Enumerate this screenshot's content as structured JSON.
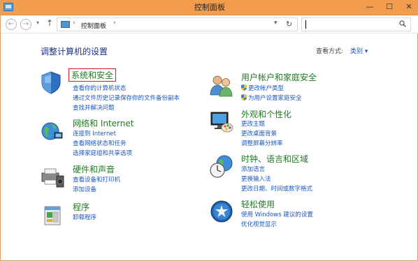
{
  "window": {
    "title": "控制面板"
  },
  "titlebar": {
    "minimize": "—",
    "maximize": "☐",
    "close": "✕"
  },
  "nav": {
    "back": "←",
    "forward": "→",
    "history": "▾",
    "up": "↑",
    "breadcrumb": "控制面板",
    "separator": "›",
    "dropdown": "▾",
    "refresh": "↻"
  },
  "search": {
    "value": "",
    "placeholder": ""
  },
  "header": {
    "heading": "调整计算机的设置",
    "view_by_label": "查看方式:",
    "view_by_value": "类别 ▾"
  },
  "categories": [
    {
      "title": "系统和安全",
      "icon": "shield-icon",
      "highlighted": true,
      "links": [
        "查看你的计算机状态",
        "通过文件历史记录保存你的文件备份副本",
        "查找并解决问题"
      ]
    },
    {
      "title": "网络和 Internet",
      "icon": "network-globe-icon",
      "links": [
        "连接到 Internet",
        "查看网络状态和任务",
        "选择家庭组和共享选项"
      ]
    },
    {
      "title": "硬件和声音",
      "icon": "printer-speaker-icon",
      "links": [
        "查看设备和打印机",
        "添加设备"
      ]
    },
    {
      "title": "程序",
      "icon": "programs-icon",
      "links": [
        "卸载程序"
      ]
    },
    {
      "title": "用户帐户和家庭安全",
      "icon": "users-icon",
      "links": [
        "更改帐户类型",
        "为用户设置家庭安全"
      ]
    },
    {
      "title": "外观和个性化",
      "icon": "monitor-palette-icon",
      "links": [
        "更改主题",
        "更改桌面背景",
        "调整屏幕分辨率"
      ]
    },
    {
      "title": "时钟、语言和区域",
      "icon": "clock-globe-icon",
      "links": [
        "添加语言",
        "更换输入法",
        "更改日期、时间或数字格式"
      ]
    },
    {
      "title": "轻松使用",
      "icon": "ease-of-access-icon",
      "links": [
        "使用 Windows 建议的设置",
        "优化视觉显示"
      ]
    }
  ],
  "colors": {
    "titlebar": "#f29c4e",
    "category_title": "#1e7b22",
    "link": "#1a56c4",
    "heading": "#1e3287",
    "highlight_box": "#d02020"
  }
}
